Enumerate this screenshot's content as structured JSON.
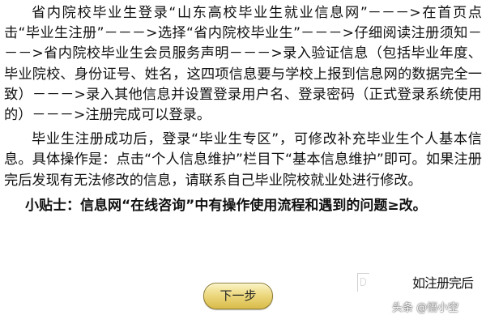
{
  "paragraphs": {
    "registration_steps": "省内院校毕业生登录“山东高校毕业生就业信息网”－－－>在首页点击“毕业生注册”－－－>选择“省内院校毕业生”－－－>仔细阅读注册须知－－－>省内院校毕业生会员服务声明－－－>录入验证信息（包括毕业年度、毕业院校、身份证号、姓名，这四项信息要与学校上报到信息网的数据完全一致）－－－>录入其他信息并设置登录用户名、登录密码（正式登录系统使用的）－－－>注册完成可以登录。",
    "after_registration": "毕业生注册成功后，登录“毕业生专区”，可修改补充毕业生个人基本信息。具体操作是：点击“个人信息维护”栏目下“基本信息维护”即可。如果注册完后发现有无法修改的信息，请联系自己毕业院校就业处进行修改。"
  },
  "tip": "小贴士：信息网“在线咨询”中有操作使用流程和遇到的问题≥改。",
  "buttons": {
    "next_step": "下一步"
  },
  "complete_label": "如注册完后",
  "watermark": "头条 @悟小空",
  "icons": {
    "page_marker": "page-corner-icon"
  },
  "colors": {
    "background": "#ffffff",
    "text": "#111111",
    "button_fill": "#ecd77d",
    "button_border": "#8c7a2c"
  }
}
